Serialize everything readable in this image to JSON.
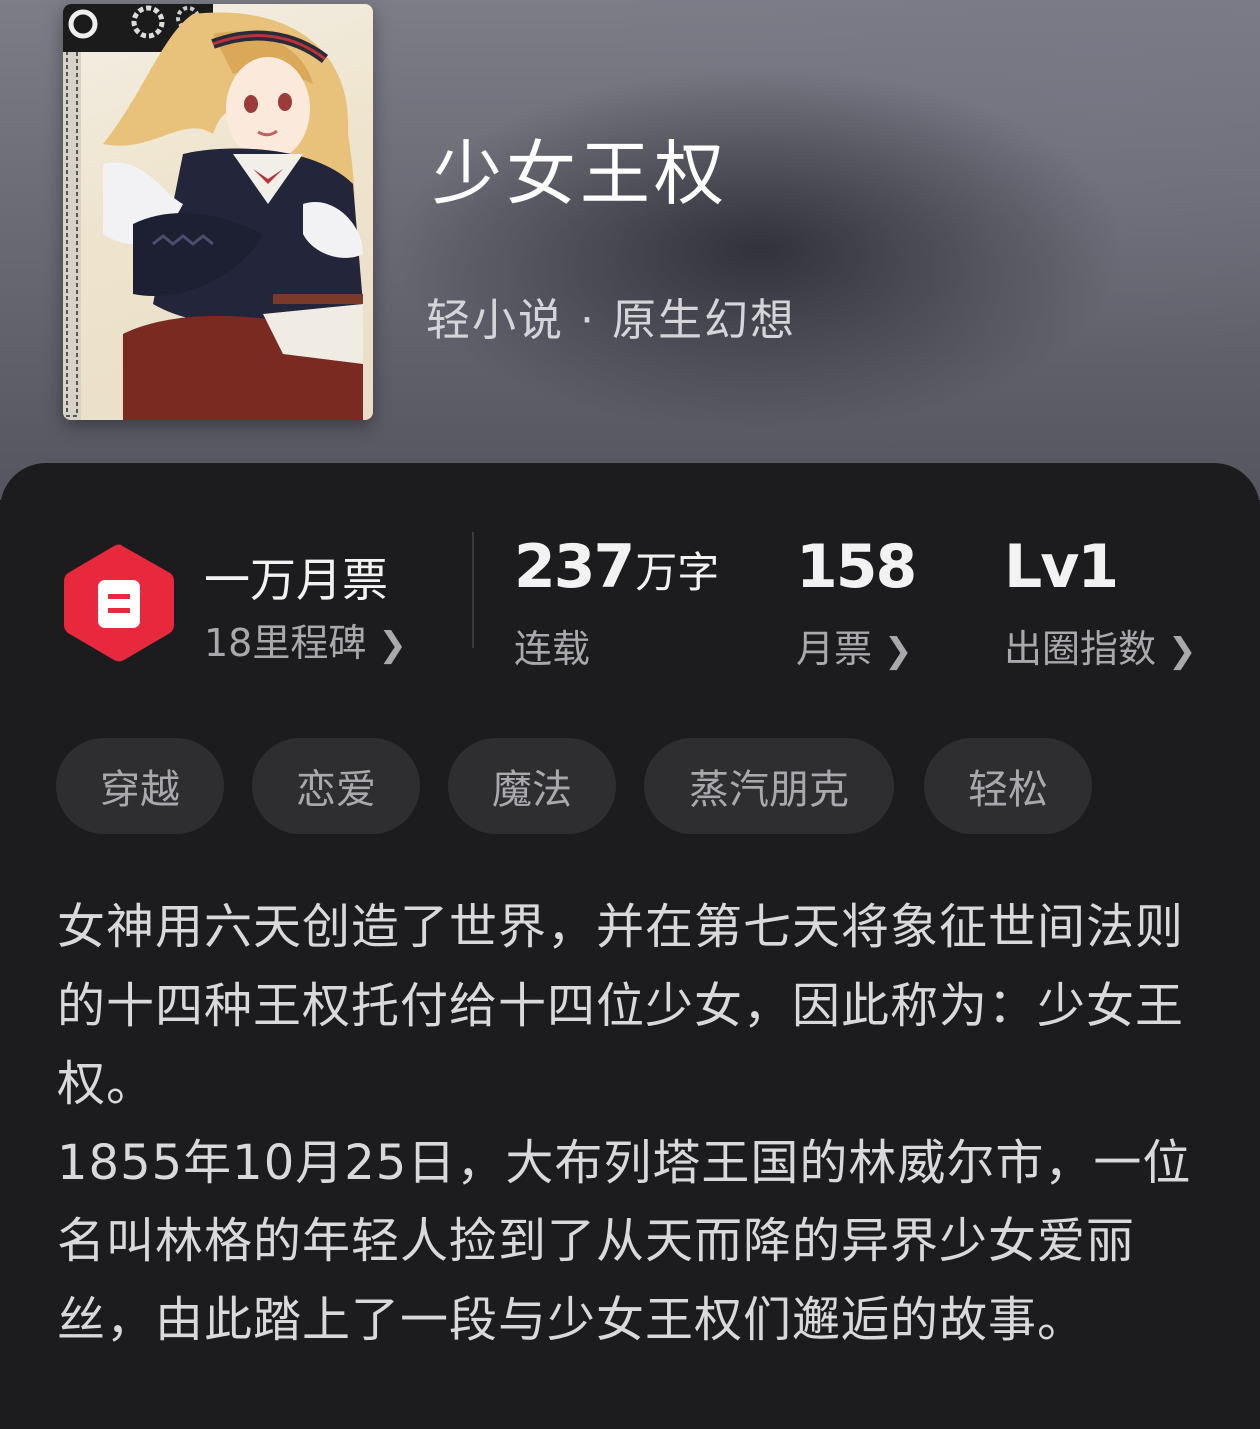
{
  "book": {
    "title": "少女王权",
    "category": "轻小说 · 原生幻想"
  },
  "stats": {
    "milestone": {
      "title": "一万月票",
      "subtitle": "18里程碑"
    },
    "words": {
      "value": "237",
      "unit": "万字",
      "label": "连载"
    },
    "monthly_tickets": {
      "value": "158",
      "label": "月票"
    },
    "level": {
      "value": "Lv1",
      "label": "出圈指数"
    }
  },
  "tags": [
    "穿越",
    "恋爱",
    "魔法",
    "蒸汽朋克",
    "轻松"
  ],
  "description": {
    "para1": "女神用六天创造了世界，并在第七天将象征世间法则的十四种王权托付给十四位少女，因此称为：少女王权。",
    "para2": "1855年10月25日，大布列塔王国的林威尔市，一位名叫林格的年轻人捡到了从天而降的异界少女爱丽丝，由此踏上了一段与少女王权们邂逅的故事。"
  },
  "colors": {
    "badge": "#e8283c",
    "card_bg": "#1c1c1e",
    "tag_bg": "#2e2e31"
  }
}
